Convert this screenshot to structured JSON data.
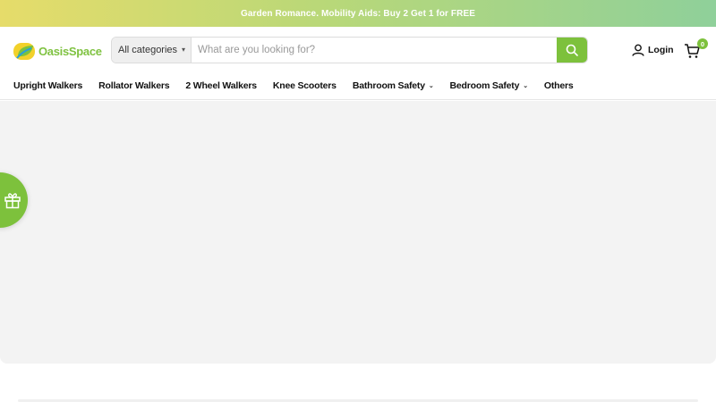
{
  "announcement": {
    "text": "Garden Romance. Mobility Aids: Buy 2 Get 1 for FREE"
  },
  "header": {
    "logo": {
      "text": "OasisSpace",
      "icon": "oasis-logo-icon"
    },
    "search": {
      "category": "All categories",
      "placeholder": "What are you looking for?",
      "button_icon": "search-icon"
    },
    "login": {
      "label": "Login",
      "icon": "user-icon"
    },
    "cart": {
      "count": "0",
      "icon": "cart-icon"
    }
  },
  "nav": {
    "items": [
      {
        "label": "Upright Walkers",
        "has_dropdown": false
      },
      {
        "label": "Rollator Walkers",
        "has_dropdown": false
      },
      {
        "label": "2 Wheel Walkers",
        "has_dropdown": false
      },
      {
        "label": "Knee Scooters",
        "has_dropdown": false
      },
      {
        "label": "Bathroom Safety",
        "has_dropdown": true
      },
      {
        "label": "Bedroom Safety",
        "has_dropdown": true
      },
      {
        "label": "Others",
        "has_dropdown": false
      }
    ]
  },
  "floating": {
    "gift_icon": "gift-icon"
  },
  "colors": {
    "accent": "#7dc13c",
    "banner_start": "#e6dc6a",
    "banner_end": "#8fd09a",
    "hero_bg": "#f3f3f3"
  }
}
